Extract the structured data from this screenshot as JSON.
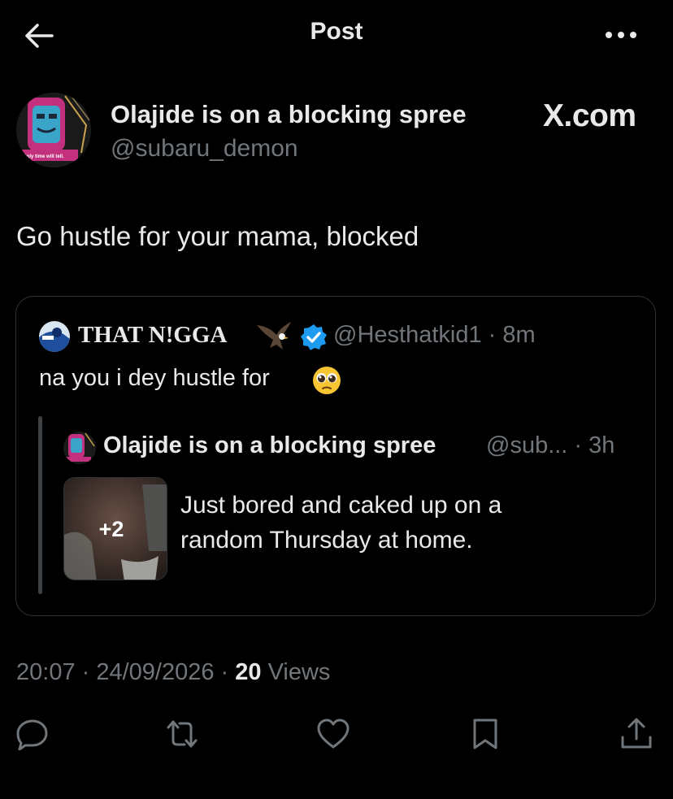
{
  "header": {
    "title": "Post",
    "back_icon": "arrow-left-icon",
    "more_icon": "more-horizontal-icon"
  },
  "post": {
    "author_name": "Olajide is on a blocking spree",
    "author_handle": "@subaru_demon",
    "avatar_caption": "Only time will tell.",
    "watermark": "X.com",
    "text": "Go hustle for your mama, blocked"
  },
  "quote": {
    "author_name": "THAT N!GGA",
    "author_handle_time": "@Hesthatkid1 · 8m",
    "text": "na you i dey hustle for",
    "verified_icon": "verified-badge-icon",
    "name_emoji": "eagle-emoji",
    "text_emoji": "pleading-face-emoji",
    "nested": {
      "author_name": "Olajide is on a blocking spree",
      "author_handle": "@sub... · 3h",
      "media_count": "+2",
      "text_line1": "Just bored and caked up on a",
      "text_line2": "random Thursday at home."
    }
  },
  "meta": {
    "datetime": "20:07 · 24/09/2026 · ",
    "views_count": "20",
    "views_label": " Views"
  },
  "actions": [
    {
      "name": "reply-icon"
    },
    {
      "name": "repost-icon"
    },
    {
      "name": "like-icon"
    },
    {
      "name": "bookmark-icon"
    },
    {
      "name": "share-icon"
    }
  ],
  "colors": {
    "background": "#000000",
    "text_primary": "#e7e9ea",
    "text_secondary": "#71767b",
    "border": "#2f3336",
    "verified_blue": "#1d9bf0"
  }
}
